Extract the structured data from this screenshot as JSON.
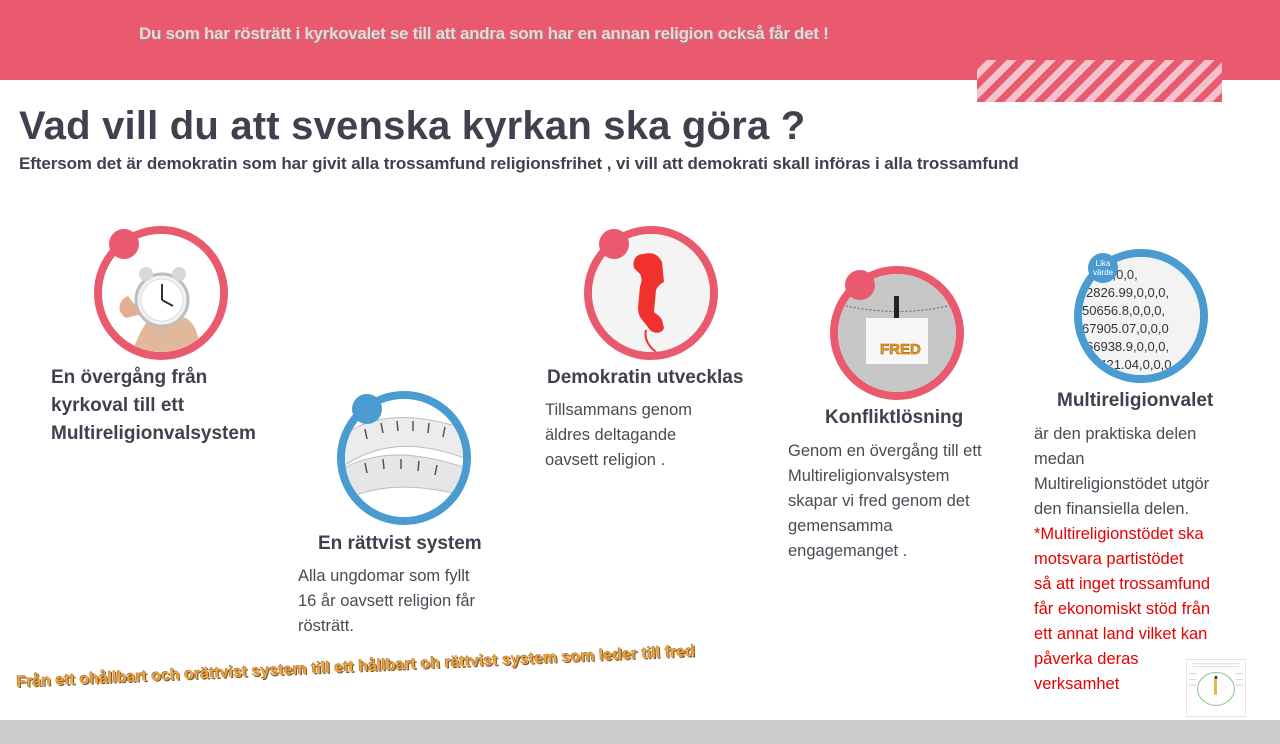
{
  "header": {
    "banner_text": "Du som har rösträtt i kyrkovalet se till att andra som har en annan religion också får det !"
  },
  "title": "Vad vill du att svenska kyrkan ska göra ?",
  "subtitle": "Eftersom det är demokratin som har givit alla trossamfund religionsfrihet , vi vill att demokrati skall införas i alla trossamfund",
  "items": [
    {
      "icon": "alarm-clock-icon",
      "heading_lines": [
        "En övergång från",
        "kyrkoval till ett",
        "Multireligionvalsystem"
      ]
    },
    {
      "icon": "tape-measure-icon",
      "heading": "En rättvist system",
      "body_lines": [
        "Alla ungdomar som fyllt",
        "16 år oavsett religion får",
        "rösträtt."
      ]
    },
    {
      "icon": "phone-receiver-icon",
      "heading": "Demokratin utvecklas",
      "body_lines": [
        "Tillsammans genom",
        "äldres deltagande",
        "oavsett religion ."
      ]
    },
    {
      "icon": "fred-sign-icon",
      "heading": "Konfliktlösning",
      "body_lines": [
        "Genom en övergång till ett",
        "Multireligionvalsystem",
        "skapar vi fred genom det",
        "gemensamma",
        "engagemanget ."
      ]
    },
    {
      "icon": "numbers-icon",
      "tag": "Lika värde",
      "heading": "Multireligionvalet",
      "body_lines": [
        "är den praktiska delen",
        "medan",
        "Multireligionstödet utgör",
        "den finansiella delen."
      ],
      "red_lines": [
        "*Multireligionstödet ska",
        "motsvara partistödet",
        "så att inget trossamfund",
        "får ekonomiskt stöd från",
        "ett annat land vilket kan",
        "påverka deras",
        "verksamhet"
      ]
    }
  ],
  "footer": {
    "slogan": "Från ett ohållbart och orättvist system till ett hållbart oh rättvist system som leder till fred"
  },
  "colors": {
    "accent_pink": "#ea5a6f",
    "accent_blue": "#4a9bd0",
    "red_text": "#e60000"
  }
}
